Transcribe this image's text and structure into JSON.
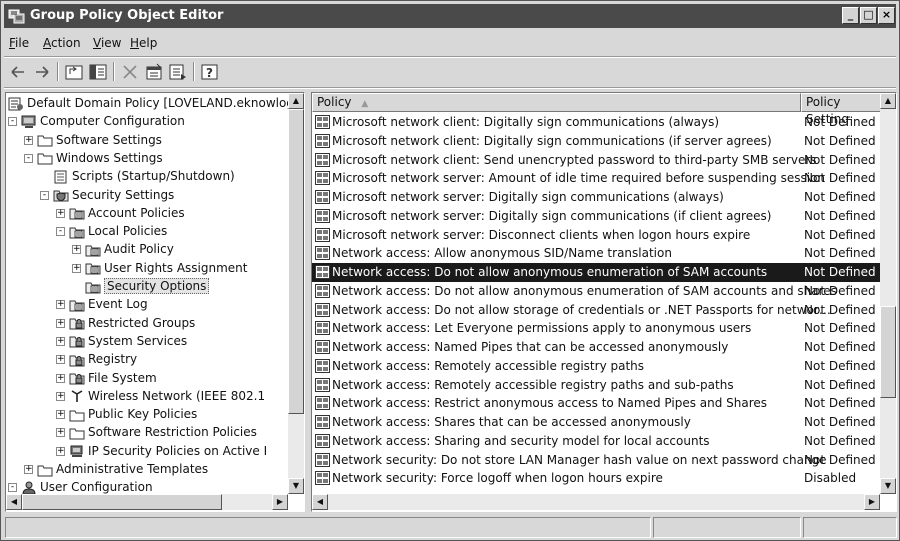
{
  "window": {
    "title": "Group Policy Object Editor"
  },
  "menu": [
    {
      "label": "File",
      "key": "F"
    },
    {
      "label": "Action",
      "key": "A"
    },
    {
      "label": "View",
      "key": "V"
    },
    {
      "label": "Help",
      "key": "H"
    }
  ],
  "toolbar": [
    "back-icon",
    "forward-icon",
    "up-folder-icon",
    "show-hide-tree-icon",
    "delete-icon",
    "properties-icon",
    "export-list-icon",
    "help-icon"
  ],
  "tree": [
    {
      "label": "Default Domain Policy [LOVELAND.eknowlogis",
      "depth": 0,
      "exp": "",
      "icon": "policy"
    },
    {
      "label": "Computer Configuration",
      "depth": 0,
      "exp": "-",
      "icon": "computer"
    },
    {
      "label": "Software Settings",
      "depth": 1,
      "exp": "+",
      "icon": "folder"
    },
    {
      "label": "Windows Settings",
      "depth": 1,
      "exp": "-",
      "icon": "folder"
    },
    {
      "label": "Scripts (Startup/Shutdown)",
      "depth": 2,
      "exp": "",
      "icon": "script"
    },
    {
      "label": "Security Settings",
      "depth": 2,
      "exp": "-",
      "icon": "security"
    },
    {
      "label": "Account Policies",
      "depth": 3,
      "exp": "+",
      "icon": "policy-folder"
    },
    {
      "label": "Local Policies",
      "depth": 3,
      "exp": "-",
      "icon": "policy-folder"
    },
    {
      "label": "Audit Policy",
      "depth": 4,
      "exp": "+",
      "icon": "policy-folder"
    },
    {
      "label": "User Rights Assignment",
      "depth": 4,
      "exp": "+",
      "icon": "policy-folder"
    },
    {
      "label": "Security Options",
      "depth": 4,
      "exp": "",
      "icon": "policy-folder",
      "selected": true
    },
    {
      "label": "Event Log",
      "depth": 3,
      "exp": "+",
      "icon": "policy-folder"
    },
    {
      "label": "Restricted Groups",
      "depth": 3,
      "exp": "+",
      "icon": "lock-folder"
    },
    {
      "label": "System Services",
      "depth": 3,
      "exp": "+",
      "icon": "lock-folder"
    },
    {
      "label": "Registry",
      "depth": 3,
      "exp": "+",
      "icon": "lock-folder"
    },
    {
      "label": "File System",
      "depth": 3,
      "exp": "+",
      "icon": "lock-folder"
    },
    {
      "label": "Wireless Network (IEEE 802.1",
      "depth": 3,
      "exp": "+",
      "icon": "antenna"
    },
    {
      "label": "Public Key Policies",
      "depth": 3,
      "exp": "+",
      "icon": "folder"
    },
    {
      "label": "Software Restriction Policies",
      "depth": 3,
      "exp": "+",
      "icon": "folder"
    },
    {
      "label": "IP Security Policies on Active I",
      "depth": 3,
      "exp": "+",
      "icon": "ipsec"
    },
    {
      "label": "Administrative Templates",
      "depth": 1,
      "exp": "+",
      "icon": "folder"
    },
    {
      "label": "User Configuration",
      "depth": 0,
      "exp": "-",
      "icon": "user"
    }
  ],
  "list": {
    "columns": [
      {
        "label": "Policy",
        "sort": "▲"
      },
      {
        "label": "Policy Setting",
        "sort": "▲"
      }
    ],
    "rows": [
      {
        "policy": "Microsoft network client: Digitally sign communications (always)",
        "setting": "Not Defined"
      },
      {
        "policy": "Microsoft network client: Digitally sign communications (if server agrees)",
        "setting": "Not Defined"
      },
      {
        "policy": "Microsoft network client: Send unencrypted password to third-party SMB servers",
        "setting": "Not Defined"
      },
      {
        "policy": "Microsoft network server: Amount of idle time required before suspending session",
        "setting": "Not Defined"
      },
      {
        "policy": "Microsoft network server: Digitally sign communications (always)",
        "setting": "Not Defined"
      },
      {
        "policy": "Microsoft network server: Digitally sign communications (if client agrees)",
        "setting": "Not Defined"
      },
      {
        "policy": "Microsoft network server: Disconnect clients when logon hours expire",
        "setting": "Not Defined"
      },
      {
        "policy": "Network access: Allow anonymous SID/Name translation",
        "setting": "Not Defined"
      },
      {
        "policy": "Network access: Do not allow anonymous enumeration of SAM accounts",
        "setting": "Not Defined",
        "selected": true
      },
      {
        "policy": "Network access: Do not allow anonymous enumeration of SAM accounts and shares",
        "setting": "Not Defined"
      },
      {
        "policy": "Network access: Do not allow storage of credentials or .NET Passports for networ…",
        "setting": "Not Defined"
      },
      {
        "policy": "Network access: Let Everyone permissions apply to anonymous users",
        "setting": "Not Defined"
      },
      {
        "policy": "Network access: Named Pipes that can be accessed anonymously",
        "setting": "Not Defined"
      },
      {
        "policy": "Network access: Remotely accessible registry paths",
        "setting": "Not Defined"
      },
      {
        "policy": "Network access: Remotely accessible registry paths and sub-paths",
        "setting": "Not Defined"
      },
      {
        "policy": "Network access: Restrict anonymous access to Named Pipes and Shares",
        "setting": "Not Defined"
      },
      {
        "policy": "Network access: Shares that can be accessed anonymously",
        "setting": "Not Defined"
      },
      {
        "policy": "Network access: Sharing and security model for local accounts",
        "setting": "Not Defined"
      },
      {
        "policy": "Network security: Do not store LAN Manager hash value on next password change",
        "setting": "Not Defined"
      },
      {
        "policy": "Network security: Force logoff when logon hours expire",
        "setting": "Disabled"
      }
    ]
  },
  "scroll": {
    "tree_vertical_position": 0.0,
    "list_vertical_position": 0.55
  },
  "status": [
    "",
    "",
    ""
  ]
}
